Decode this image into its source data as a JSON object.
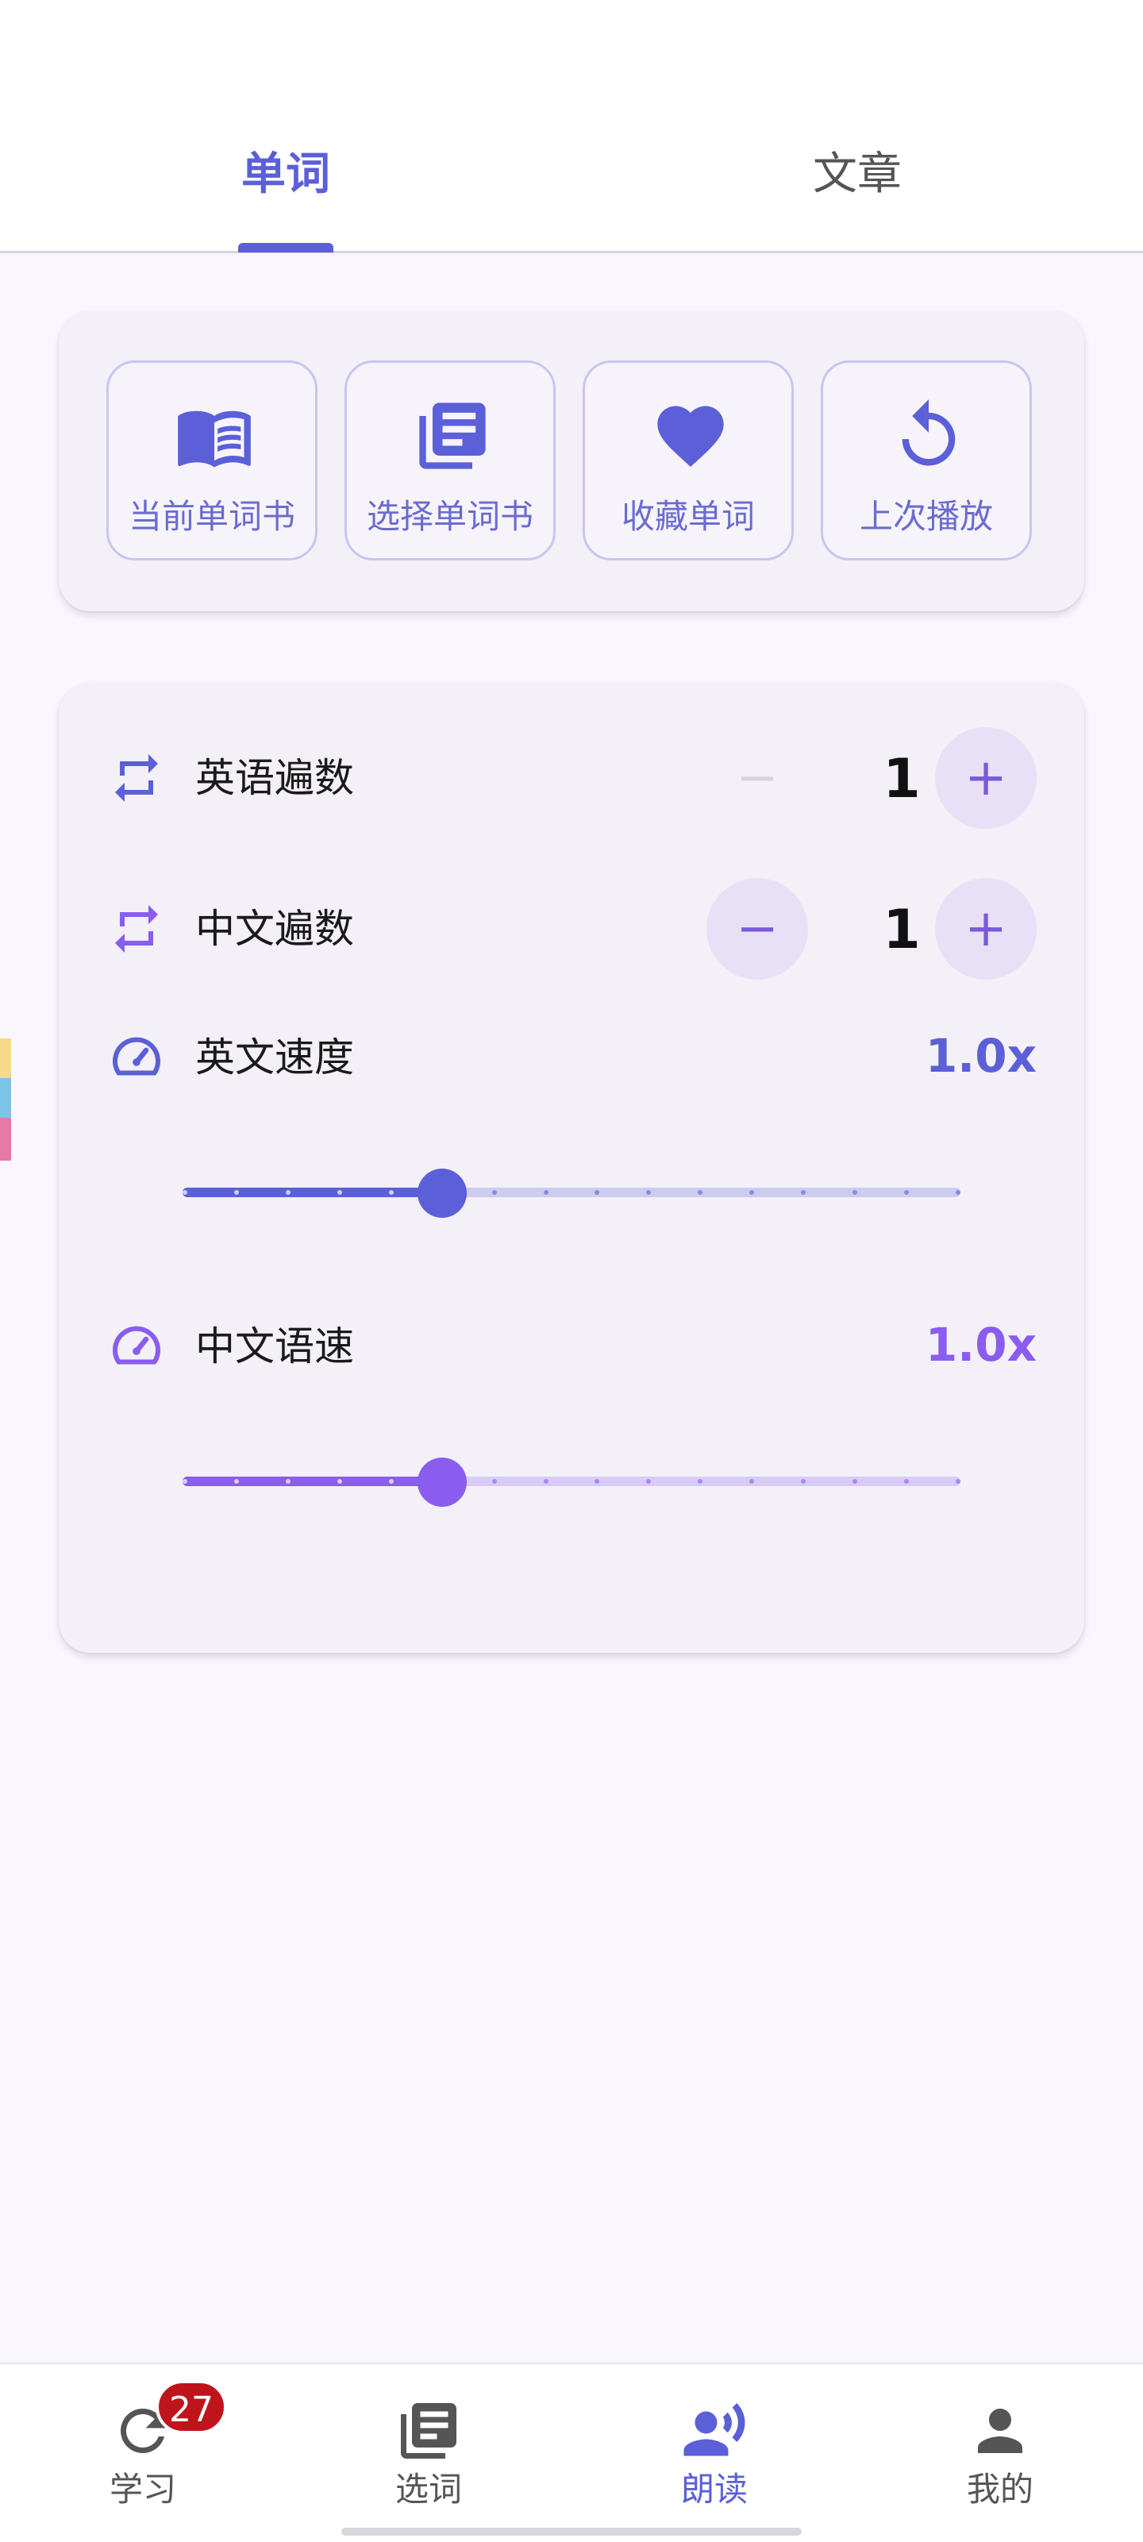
{
  "tabs": [
    {
      "label": "单词",
      "active": true
    },
    {
      "label": "文章",
      "active": false
    }
  ],
  "quick_actions": [
    {
      "label": "当前单词书",
      "icon": "open-book-icon"
    },
    {
      "label": "选择单词书",
      "icon": "library-books-icon"
    },
    {
      "label": "收藏单词",
      "icon": "heart-icon"
    },
    {
      "label": "上次播放",
      "icon": "replay-icon"
    }
  ],
  "settings": {
    "english_repeat": {
      "label": "英语遍数",
      "value": "1",
      "minus_label": "−",
      "plus_label": "+"
    },
    "chinese_repeat": {
      "label": "中文遍数",
      "value": "1",
      "minus_label": "−",
      "plus_label": "+"
    },
    "english_speed": {
      "label": "英文速度",
      "value_label": "1.0x",
      "fraction": 0.3333
    },
    "chinese_speed": {
      "label": "中文语速",
      "value_label": "1.0x",
      "fraction": 0.3333
    }
  },
  "bottom_nav": [
    {
      "label": "学习",
      "icon": "refresh-icon",
      "badge": "27",
      "active": false
    },
    {
      "label": "选词",
      "icon": "library-books-icon",
      "active": false
    },
    {
      "label": "朗读",
      "icon": "speaking-person-icon",
      "active": true
    },
    {
      "label": "我的",
      "icon": "person-icon",
      "active": false
    }
  ],
  "colors": {
    "accent": "#5b5fd8",
    "english_slider": "#5b5fd8",
    "chinese_slider": "#8a5cf0",
    "badge": "#c0141c"
  }
}
